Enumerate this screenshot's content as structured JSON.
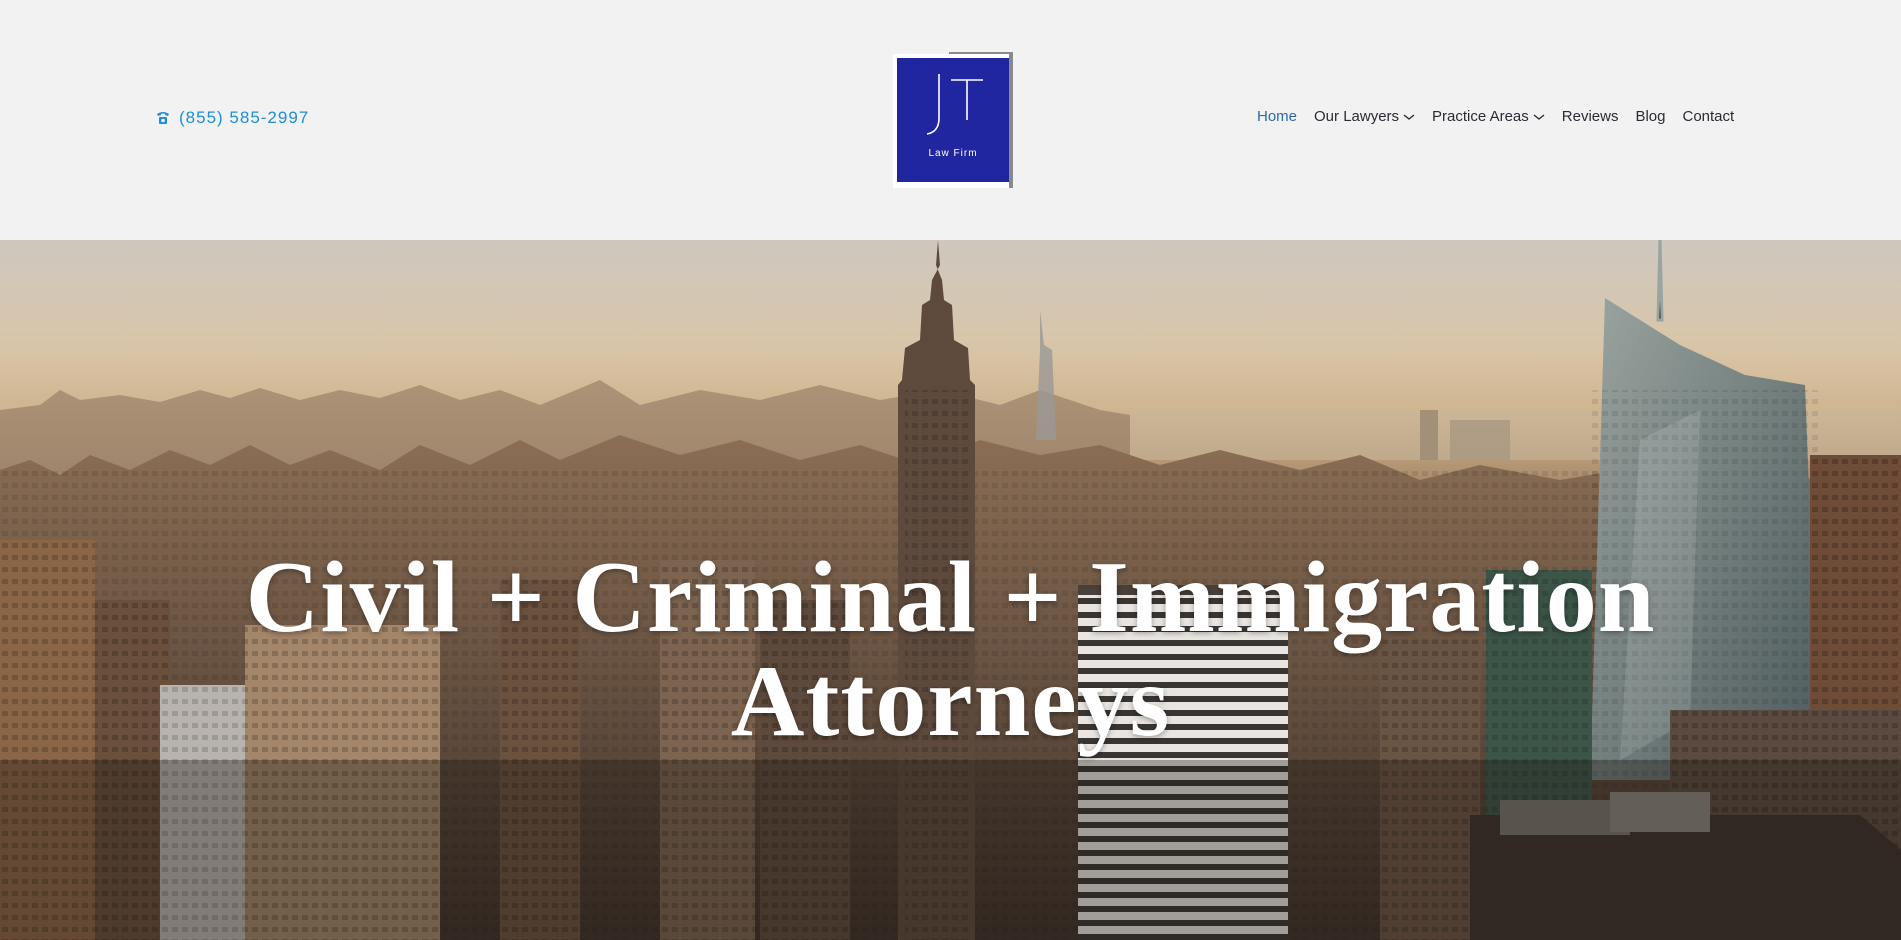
{
  "header": {
    "phone": "(855) 585-2997",
    "phone_icon": "phone-icon",
    "logo": {
      "letters": "JT",
      "subtitle": "Law Firm",
      "colors": {
        "blue": "#2026a0",
        "gray": "#8a8a8e"
      }
    }
  },
  "nav": {
    "items": [
      {
        "label": "Home",
        "active": true
      },
      {
        "label": "Our Lawyers",
        "dropdown": true
      },
      {
        "label": "Practice Areas",
        "dropdown": true
      },
      {
        "label": "Reviews"
      },
      {
        "label": "Blog"
      },
      {
        "label": "Contact"
      }
    ]
  },
  "hero": {
    "title_line1": "Civil + Criminal + Immigration",
    "title_line2": "Attorneys",
    "background": "city-skyline-image"
  },
  "colors": {
    "accent": "#1e8fd6",
    "nav_active": "#2d6aa8",
    "nav_text": "#2b2b36",
    "header_bg": "#f2f2f2"
  }
}
